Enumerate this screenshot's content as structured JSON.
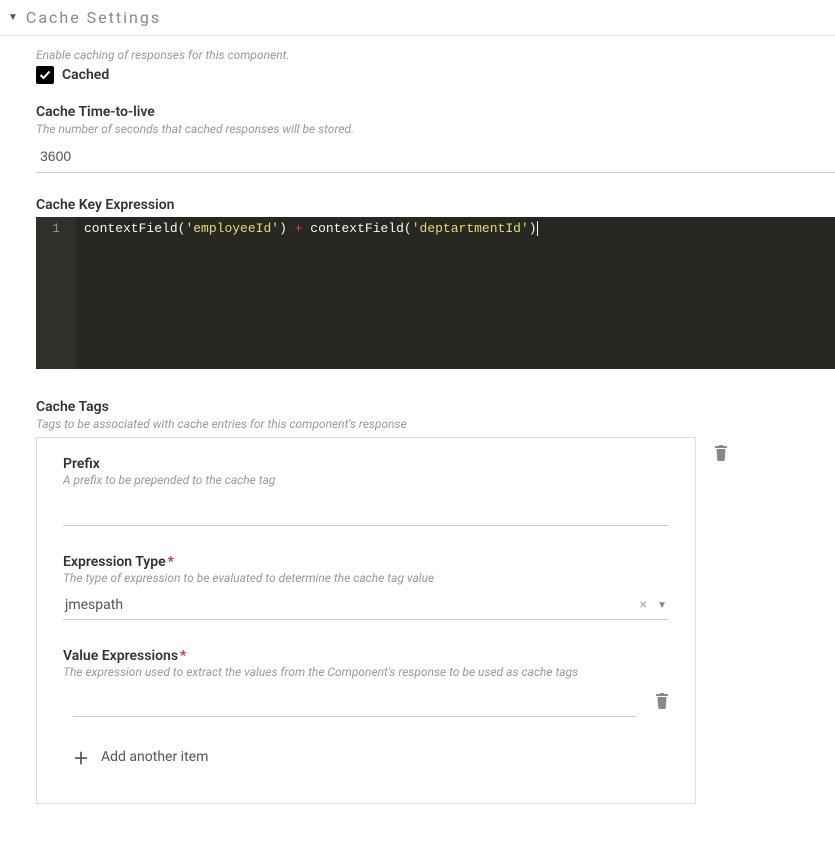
{
  "section": {
    "title": "Cache Settings"
  },
  "cached": {
    "desc": "Enable caching of responses for this component.",
    "label": "Cached",
    "checked": true
  },
  "ttl": {
    "label": "Cache Time-to-live",
    "desc": "The number of seconds that cached responses will be stored.",
    "value": "3600"
  },
  "keyExpr": {
    "label": "Cache Key Expression",
    "lineNumber": "1",
    "tokens": {
      "fn": "contextField",
      "str1": "'employeeId'",
      "op": " + ",
      "str2": "'deptartmentId'"
    }
  },
  "tags": {
    "label": "Cache Tags",
    "desc": "Tags to be associated with cache entries for this component's response",
    "prefix": {
      "label": "Prefix",
      "desc": "A prefix to be prepended to the cache tag",
      "value": ""
    },
    "exprType": {
      "label": "Expression Type",
      "desc": "The type of expression to be evaluated to determine the cache tag value",
      "value": "jmespath"
    },
    "valueExpr": {
      "label": "Value Expressions",
      "desc": "The expression used to extract the values from the Component's response to be used as cache tags",
      "value": ""
    },
    "addAnother": "Add another item"
  }
}
